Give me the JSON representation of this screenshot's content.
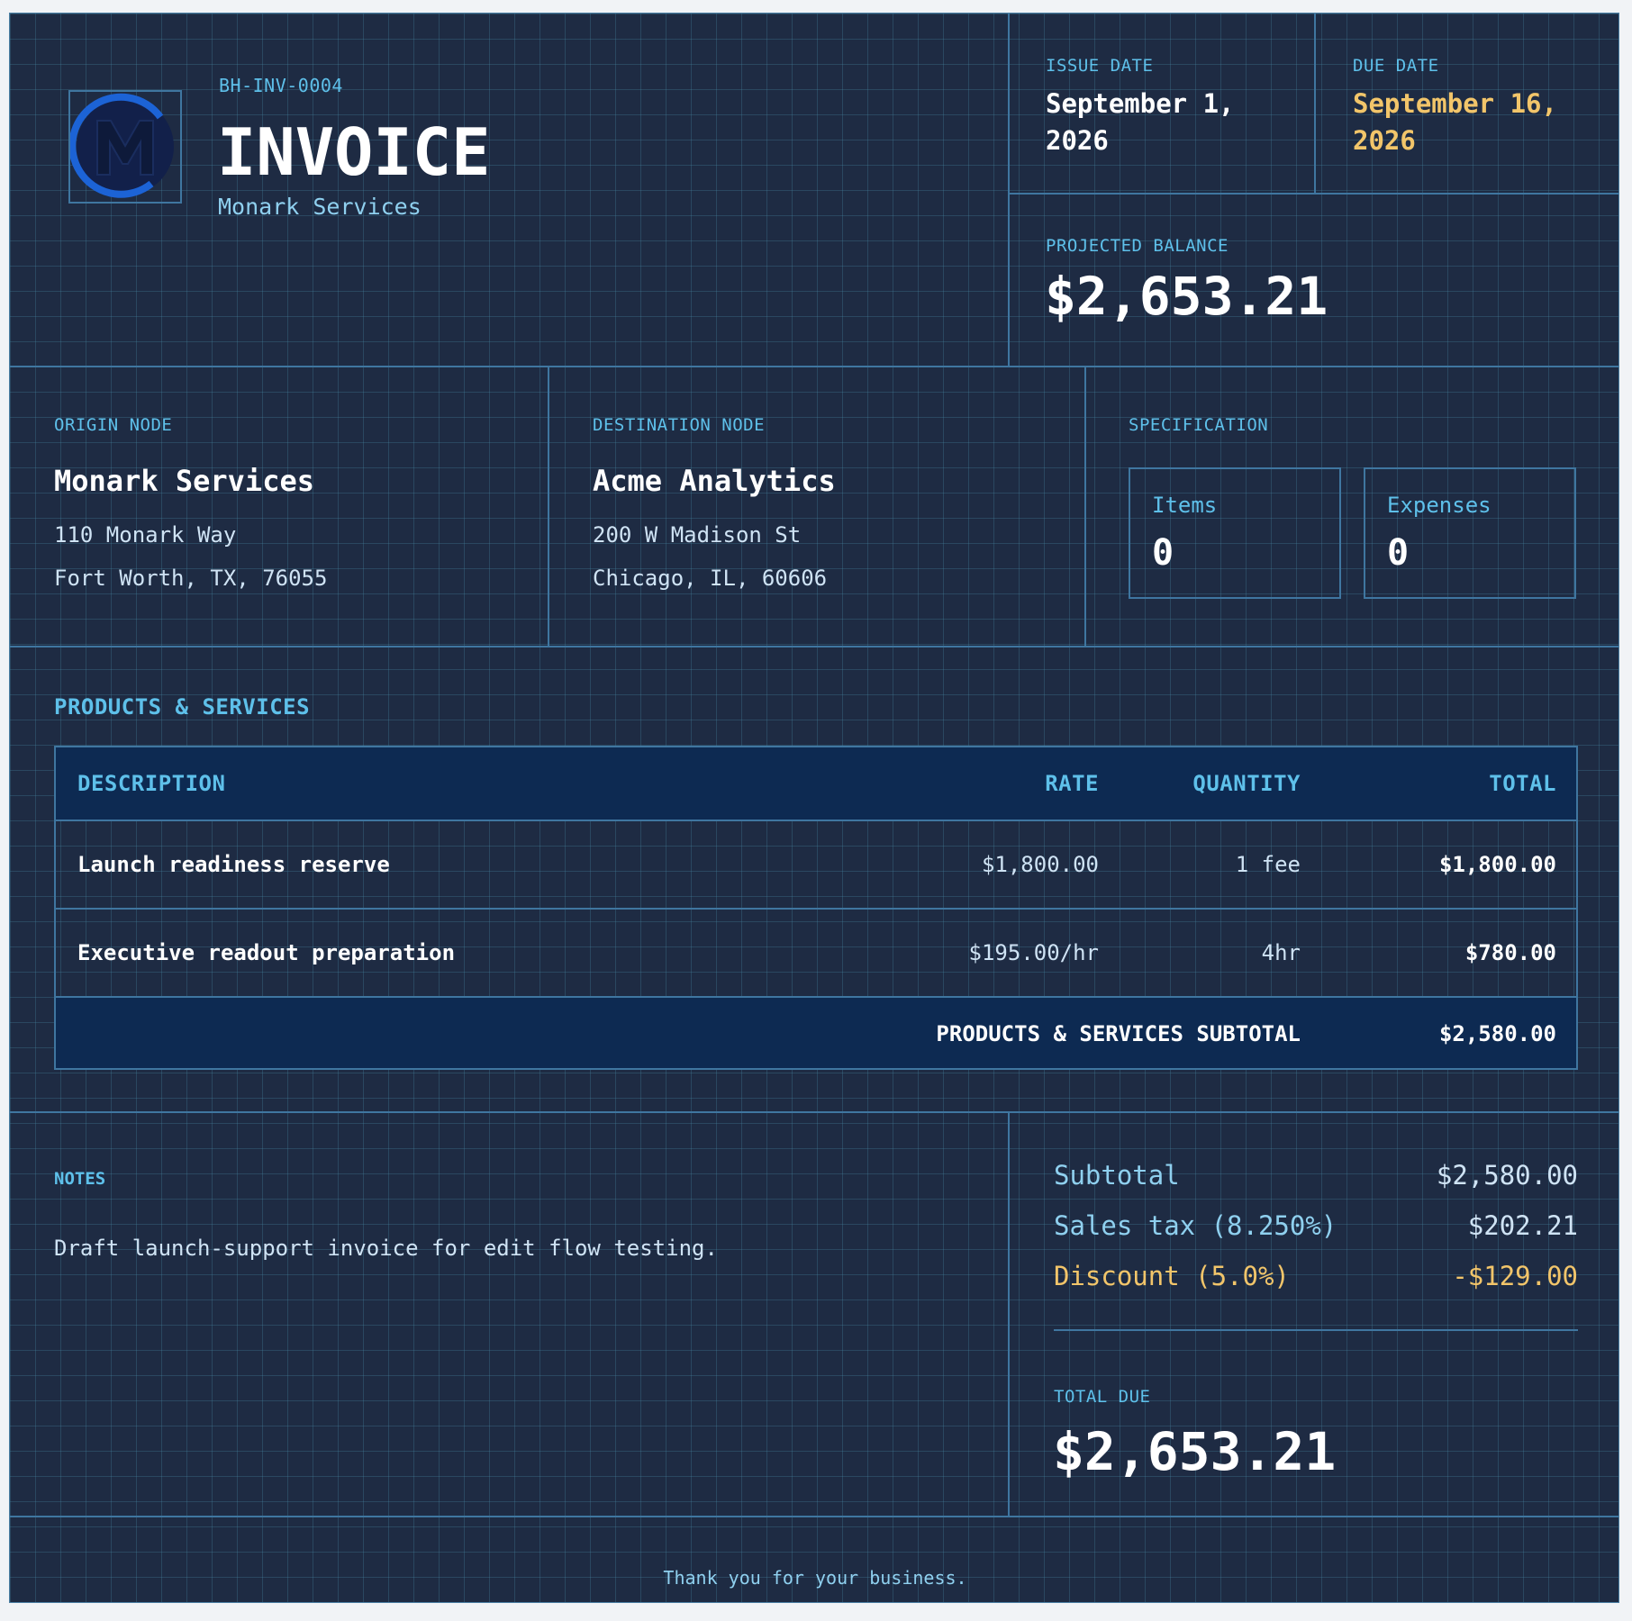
{
  "header": {
    "invoice_id": "BH-INV-0004",
    "title": "INVOICE",
    "company": "Monark Services",
    "logo_letter": "M",
    "issue_date_label": "ISSUE DATE",
    "issue_date_line1": "September 1,",
    "issue_date_line2": "2026",
    "due_date_label": "DUE DATE",
    "due_date_line1": "September 16,",
    "due_date_line2": "2026",
    "balance_label": "PROJECTED BALANCE",
    "balance_value": "$2,653.21"
  },
  "origin": {
    "label": "ORIGIN NODE",
    "name": "Monark Services",
    "address1": "110 Monark Way",
    "address2": "Fort Worth, TX, 76055"
  },
  "destination": {
    "label": "DESTINATION NODE",
    "name": "Acme Analytics",
    "address1": "200 W Madison St",
    "address2": "Chicago, IL, 60606"
  },
  "specification": {
    "label": "SPECIFICATION",
    "items_label": "Items",
    "items_value": "0",
    "expenses_label": "Expenses",
    "expenses_value": "0"
  },
  "products": {
    "section_title": "PRODUCTS & SERVICES",
    "columns": {
      "description": "DESCRIPTION",
      "rate": "RATE",
      "quantity": "QUANTITY",
      "total": "TOTAL"
    },
    "rows": [
      {
        "description": "Launch readiness reserve",
        "rate": "$1,800.00",
        "quantity": "1 fee",
        "total": "$1,800.00"
      },
      {
        "description": "Executive readout preparation",
        "rate": "$195.00/hr",
        "quantity": "4hr",
        "total": "$780.00"
      }
    ],
    "subtotal_label": "PRODUCTS & SERVICES SUBTOTAL",
    "subtotal_value": "$2,580.00"
  },
  "notes": {
    "label": "NOTES",
    "text": "Draft launch-support invoice for edit flow testing."
  },
  "summary": {
    "subtotal_label": "Subtotal",
    "subtotal_value": "$2,580.00",
    "tax_label": "Sales tax (8.250%)",
    "tax_value": "$202.21",
    "discount_label": "Discount (5.0%)",
    "discount_value": "-$129.00",
    "total_due_label": "TOTAL DUE",
    "total_due_value": "$2,653.21"
  },
  "footer": {
    "text": "Thank you for your business."
  },
  "colors": {
    "background": "#1e2b43",
    "grid_line": "#3f76a0",
    "accent_cyan": "#5ec0ea",
    "accent_gold": "#f2c56a",
    "table_header": "#0d2a52",
    "logo_blue": "#1c63d6"
  }
}
